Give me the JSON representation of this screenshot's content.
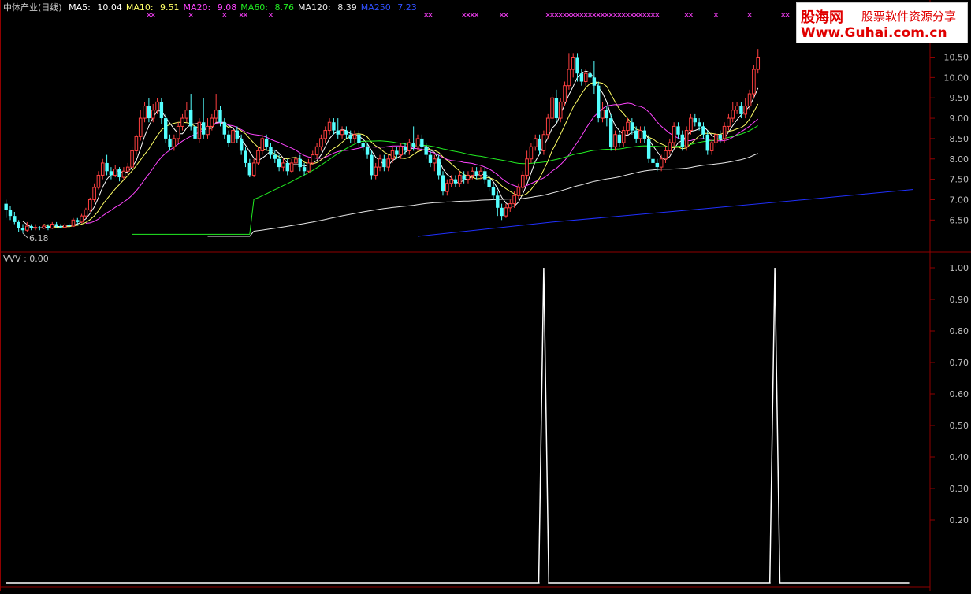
{
  "main_header": {
    "title": "中体产业(日线)",
    "items": [
      {
        "label": "MA5:",
        "value": "10.04",
        "color": "#ffffff"
      },
      {
        "label": "MA10:",
        "value": "9.51",
        "color": "#ffff66"
      },
      {
        "label": "MA20:",
        "value": "9.08",
        "color": "#ff44ff"
      },
      {
        "label": "MA60:",
        "value": "8.76",
        "color": "#22ee22"
      },
      {
        "label": "MA120:",
        "value": "8.39",
        "color": "#e8e8e8"
      },
      {
        "label": "MA250",
        "value": "7.23",
        "color": "#3050ff"
      }
    ]
  },
  "watermark": {
    "line1": "股海网",
    "line1b": "股票软件资源分享",
    "line2": "Www.Guhai.com.cn"
  },
  "sub_header": {
    "label": "VVV",
    "value": "0.00"
  },
  "colors": {
    "up": "#ff4040",
    "down": "#54ffff",
    "grid": "#900000",
    "axis_text": "#c0c0c0",
    "marker": "#ff40ff",
    "vvv": "#ffffff"
  },
  "chart_data": [
    {
      "type": "candlestick",
      "y_ticks": [
        6.5,
        7.0,
        7.5,
        8.0,
        8.5,
        9.0,
        9.5,
        10.0,
        10.5
      ],
      "ylim": [
        6.1,
        10.8
      ],
      "min_label": "6.18",
      "marker_symbol": "×",
      "marker_days": [
        34,
        35,
        44,
        52,
        56,
        57,
        63,
        100,
        101,
        109,
        110,
        111,
        112,
        118,
        119,
        129,
        130,
        131,
        132,
        133,
        134,
        135,
        136,
        137,
        138,
        139,
        140,
        141,
        142,
        143,
        144,
        145,
        146,
        147,
        148,
        149,
        150,
        151,
        152,
        153,
        154,
        155,
        162,
        163,
        169,
        177,
        185,
        186
      ],
      "ohlc": [
        [
          6.9,
          6.75,
          7.0,
          6.55
        ],
        [
          6.75,
          6.6,
          6.85,
          6.5
        ],
        [
          6.6,
          6.45,
          6.7,
          6.4
        ],
        [
          6.45,
          6.3,
          6.5,
          6.2
        ],
        [
          6.3,
          6.25,
          6.4,
          6.18
        ],
        [
          6.25,
          6.35,
          6.45,
          6.2
        ],
        [
          6.35,
          6.3,
          6.4,
          6.25
        ],
        [
          6.3,
          6.32,
          6.4,
          6.25
        ],
        [
          6.32,
          6.3,
          6.35,
          6.25
        ],
        [
          6.3,
          6.35,
          6.4,
          6.28
        ],
        [
          6.35,
          6.3,
          6.4,
          6.25
        ],
        [
          6.3,
          6.4,
          6.45,
          6.28
        ],
        [
          6.4,
          6.35,
          6.45,
          6.3
        ],
        [
          6.35,
          6.32,
          6.4,
          6.3
        ],
        [
          6.32,
          6.38,
          6.42,
          6.3
        ],
        [
          6.38,
          6.35,
          6.42,
          6.3
        ],
        [
          6.35,
          6.5,
          6.55,
          6.33
        ],
        [
          6.5,
          6.45,
          6.55,
          6.4
        ],
        [
          6.45,
          6.6,
          6.65,
          6.42
        ],
        [
          6.6,
          6.75,
          6.8,
          6.55
        ],
        [
          6.75,
          7.0,
          7.05,
          6.7
        ],
        [
          7.0,
          7.3,
          7.4,
          6.95
        ],
        [
          7.3,
          7.6,
          7.7,
          7.25
        ],
        [
          7.6,
          7.9,
          8.0,
          7.5
        ],
        [
          7.9,
          7.7,
          8.1,
          7.6
        ],
        [
          7.7,
          7.6,
          7.8,
          7.5
        ],
        [
          7.6,
          7.75,
          7.85,
          7.55
        ],
        [
          7.75,
          7.55,
          7.8,
          7.45
        ],
        [
          7.55,
          7.7,
          7.8,
          7.5
        ],
        [
          7.7,
          7.8,
          7.9,
          7.6
        ],
        [
          7.8,
          8.2,
          8.3,
          7.75
        ],
        [
          8.2,
          8.55,
          8.6,
          8.1
        ],
        [
          8.55,
          9.0,
          9.2,
          8.45
        ],
        [
          9.0,
          9.3,
          9.4,
          8.9
        ],
        [
          9.3,
          9.0,
          9.5,
          8.9
        ],
        [
          9.0,
          9.2,
          9.35,
          8.9
        ],
        [
          9.2,
          9.4,
          9.5,
          9.1
        ],
        [
          9.4,
          9.0,
          9.5,
          8.85
        ],
        [
          9.0,
          8.5,
          9.1,
          8.4
        ],
        [
          8.5,
          8.3,
          8.6,
          8.2
        ],
        [
          8.3,
          8.5,
          8.6,
          8.2
        ],
        [
          8.5,
          8.8,
          8.9,
          8.4
        ],
        [
          8.8,
          9.0,
          9.1,
          8.7
        ],
        [
          9.0,
          9.2,
          9.4,
          8.9
        ],
        [
          9.2,
          8.8,
          9.6,
          8.7
        ],
        [
          8.8,
          8.5,
          8.9,
          8.4
        ],
        [
          8.5,
          8.9,
          9.0,
          8.4
        ],
        [
          8.9,
          8.6,
          9.5,
          8.5
        ],
        [
          8.6,
          8.8,
          9.0,
          8.5
        ],
        [
          8.8,
          9.0,
          9.1,
          8.7
        ],
        [
          9.0,
          9.2,
          9.6,
          8.9
        ],
        [
          9.2,
          8.9,
          9.3,
          8.8
        ],
        [
          8.9,
          8.6,
          9.0,
          8.5
        ],
        [
          8.6,
          8.4,
          8.7,
          8.3
        ],
        [
          8.4,
          8.7,
          8.8,
          8.3
        ],
        [
          8.7,
          8.5,
          8.8,
          8.4
        ],
        [
          8.5,
          8.2,
          8.6,
          8.1
        ],
        [
          8.2,
          7.9,
          8.3,
          7.8
        ],
        [
          7.9,
          7.6,
          8.0,
          7.55
        ],
        [
          7.6,
          7.9,
          8.0,
          7.55
        ],
        [
          7.9,
          8.2,
          8.3,
          7.85
        ],
        [
          8.2,
          8.5,
          8.6,
          8.1
        ],
        [
          8.5,
          8.3,
          8.6,
          8.2
        ],
        [
          8.3,
          8.1,
          8.4,
          8.0
        ],
        [
          8.1,
          8.0,
          8.2,
          7.9
        ],
        [
          8.0,
          7.8,
          8.1,
          7.7
        ],
        [
          7.8,
          7.9,
          8.0,
          7.7
        ],
        [
          7.9,
          7.7,
          8.0,
          7.6
        ],
        [
          7.7,
          7.9,
          8.0,
          7.65
        ],
        [
          7.9,
          8.0,
          8.1,
          7.8
        ],
        [
          8.0,
          7.8,
          8.1,
          7.7
        ],
        [
          7.8,
          7.7,
          7.9,
          7.6
        ],
        [
          7.7,
          7.9,
          8.0,
          7.65
        ],
        [
          7.9,
          8.1,
          8.2,
          7.85
        ],
        [
          8.1,
          8.3,
          8.4,
          8.0
        ],
        [
          8.3,
          8.5,
          8.6,
          8.2
        ],
        [
          8.5,
          8.7,
          8.8,
          8.4
        ],
        [
          8.7,
          8.9,
          9.0,
          8.6
        ],
        [
          8.9,
          8.7,
          9.0,
          8.6
        ],
        [
          8.7,
          8.6,
          9.0,
          8.5
        ],
        [
          8.6,
          8.7,
          8.8,
          8.5
        ],
        [
          8.7,
          8.6,
          8.8,
          8.5
        ],
        [
          8.6,
          8.5,
          8.7,
          8.4
        ],
        [
          8.5,
          8.6,
          8.7,
          8.4
        ],
        [
          8.6,
          8.4,
          8.7,
          8.3
        ],
        [
          8.4,
          8.3,
          8.5,
          8.2
        ],
        [
          8.3,
          8.1,
          8.4,
          8.0
        ],
        [
          8.1,
          7.6,
          8.2,
          7.5
        ],
        [
          7.6,
          7.8,
          7.9,
          7.5
        ],
        [
          7.8,
          8.0,
          8.1,
          7.7
        ],
        [
          8.0,
          7.8,
          8.1,
          7.7
        ],
        [
          7.8,
          8.0,
          8.1,
          7.7
        ],
        [
          8.0,
          8.2,
          8.3,
          7.9
        ],
        [
          8.2,
          8.1,
          8.3,
          8.0
        ],
        [
          8.1,
          8.3,
          8.4,
          8.0
        ],
        [
          8.3,
          8.2,
          8.4,
          8.1
        ],
        [
          8.2,
          8.4,
          8.5,
          8.1
        ],
        [
          8.4,
          8.3,
          8.8,
          8.2
        ],
        [
          8.3,
          8.5,
          8.6,
          8.2
        ],
        [
          8.5,
          8.3,
          8.6,
          8.2
        ],
        [
          8.3,
          8.1,
          8.4,
          8.0
        ],
        [
          8.1,
          7.9,
          8.2,
          7.8
        ],
        [
          7.9,
          8.0,
          8.1,
          7.7
        ],
        [
          8.0,
          7.6,
          8.1,
          7.5
        ],
        [
          7.6,
          7.2,
          7.7,
          7.1
        ],
        [
          7.2,
          7.4,
          7.5,
          7.1
        ],
        [
          7.4,
          7.5,
          7.6,
          7.3
        ],
        [
          7.5,
          7.4,
          7.6,
          7.3
        ],
        [
          7.4,
          7.6,
          7.7,
          7.3
        ],
        [
          7.6,
          7.5,
          7.7,
          7.4
        ],
        [
          7.5,
          7.6,
          7.7,
          7.4
        ],
        [
          7.6,
          7.7,
          7.8,
          7.5
        ],
        [
          7.7,
          7.6,
          7.8,
          7.5
        ],
        [
          7.6,
          7.7,
          7.8,
          7.5
        ],
        [
          7.7,
          7.5,
          7.8,
          7.4
        ],
        [
          7.5,
          7.3,
          7.6,
          7.2
        ],
        [
          7.3,
          7.1,
          7.4,
          7.0
        ],
        [
          7.1,
          6.8,
          7.2,
          6.6
        ],
        [
          6.8,
          6.6,
          6.9,
          6.5
        ],
        [
          6.6,
          6.8,
          6.9,
          6.55
        ],
        [
          6.8,
          6.9,
          7.0,
          6.7
        ],
        [
          6.9,
          7.1,
          7.2,
          6.8
        ],
        [
          7.1,
          7.3,
          7.4,
          7.0
        ],
        [
          7.3,
          7.6,
          7.7,
          7.2
        ],
        [
          7.6,
          8.0,
          8.2,
          7.5
        ],
        [
          8.0,
          8.3,
          8.4,
          7.9
        ],
        [
          8.3,
          8.5,
          8.6,
          8.2
        ],
        [
          8.5,
          8.2,
          8.6,
          8.1
        ],
        [
          8.2,
          8.6,
          8.7,
          8.1
        ],
        [
          8.6,
          9.0,
          9.1,
          8.5
        ],
        [
          9.0,
          9.5,
          9.6,
          8.9
        ],
        [
          9.5,
          9.0,
          9.7,
          8.9
        ],
        [
          9.0,
          9.4,
          9.5,
          8.9
        ],
        [
          9.4,
          9.8,
          9.9,
          9.3
        ],
        [
          9.8,
          10.2,
          10.6,
          9.7
        ],
        [
          10.2,
          10.5,
          10.6,
          10.0
        ],
        [
          10.5,
          10.1,
          10.6,
          9.9
        ],
        [
          10.1,
          9.9,
          10.2,
          9.8
        ],
        [
          9.9,
          10.1,
          10.2,
          9.8
        ],
        [
          10.1,
          10.0,
          10.3,
          9.8
        ],
        [
          10.0,
          9.8,
          10.4,
          9.6
        ],
        [
          9.8,
          9.0,
          9.9,
          8.9
        ],
        [
          9.0,
          9.2,
          9.4,
          8.9
        ],
        [
          9.2,
          9.0,
          9.3,
          8.8
        ],
        [
          9.0,
          8.3,
          9.1,
          8.2
        ],
        [
          8.3,
          8.6,
          8.7,
          8.2
        ],
        [
          8.6,
          8.4,
          8.7,
          8.3
        ],
        [
          8.4,
          8.7,
          8.8,
          8.3
        ],
        [
          8.7,
          8.9,
          9.0,
          8.6
        ],
        [
          8.9,
          8.7,
          9.0,
          8.6
        ],
        [
          8.7,
          8.5,
          8.8,
          8.4
        ],
        [
          8.5,
          8.7,
          8.8,
          8.4
        ],
        [
          8.7,
          8.5,
          8.8,
          8.4
        ],
        [
          8.5,
          8.0,
          8.6,
          7.9
        ],
        [
          8.0,
          7.9,
          8.1,
          7.8
        ],
        [
          7.9,
          7.8,
          8.0,
          7.7
        ],
        [
          7.8,
          8.0,
          8.1,
          7.7
        ],
        [
          8.0,
          8.2,
          8.3,
          7.9
        ],
        [
          8.2,
          8.4,
          8.5,
          8.1
        ],
        [
          8.4,
          8.8,
          8.9,
          8.3
        ],
        [
          8.8,
          8.6,
          8.9,
          8.5
        ],
        [
          8.6,
          8.3,
          8.7,
          8.2
        ],
        [
          8.3,
          8.7,
          8.8,
          8.2
        ],
        [
          8.7,
          9.0,
          9.1,
          8.6
        ],
        [
          9.0,
          8.9,
          9.1,
          8.8
        ],
        [
          8.9,
          8.8,
          9.0,
          8.7
        ],
        [
          8.8,
          8.6,
          8.9,
          8.5
        ],
        [
          8.6,
          8.2,
          8.7,
          8.1
        ],
        [
          8.2,
          8.4,
          8.5,
          8.1
        ],
        [
          8.4,
          8.6,
          8.7,
          8.3
        ],
        [
          8.6,
          8.5,
          8.7,
          8.4
        ],
        [
          8.5,
          8.8,
          8.9,
          8.4
        ],
        [
          8.8,
          9.0,
          9.1,
          8.7
        ],
        [
          9.0,
          9.2,
          9.4,
          8.9
        ],
        [
          9.2,
          9.3,
          9.4,
          9.1
        ],
        [
          9.3,
          9.1,
          9.4,
          9.0
        ],
        [
          9.1,
          9.3,
          9.5,
          9.0
        ],
        [
          9.3,
          9.6,
          9.7,
          9.2
        ],
        [
          9.6,
          10.2,
          10.3,
          9.5
        ],
        [
          10.2,
          10.5,
          10.7,
          10.1
        ]
      ],
      "ma": [
        {
          "period": 5,
          "color": "#ffffff"
        },
        {
          "period": 10,
          "color": "#ffff66"
        },
        {
          "period": 20,
          "color": "#ff44ff"
        },
        {
          "period": 60,
          "color": "#22ee22",
          "from_value": 6.15,
          "start": 30
        },
        {
          "period": 120,
          "color": "#e8e8e8",
          "from_value": 6.1,
          "start": 48
        },
        {
          "period": 250,
          "color": "#2030ff",
          "pts": [
            [
              98,
              6.1
            ],
            [
              130,
              6.45
            ],
            [
              160,
              6.72
            ],
            [
              190,
              7.0
            ],
            [
              216,
              7.25
            ]
          ]
        }
      ]
    },
    {
      "type": "line",
      "name": "VVV",
      "y_ticks": [
        0.2,
        0.3,
        0.4,
        0.5,
        0.6,
        0.7,
        0.8,
        0.9,
        1.0
      ],
      "ylim": [
        0,
        1
      ],
      "spikes_at": [
        128,
        183
      ],
      "length": 216
    }
  ]
}
